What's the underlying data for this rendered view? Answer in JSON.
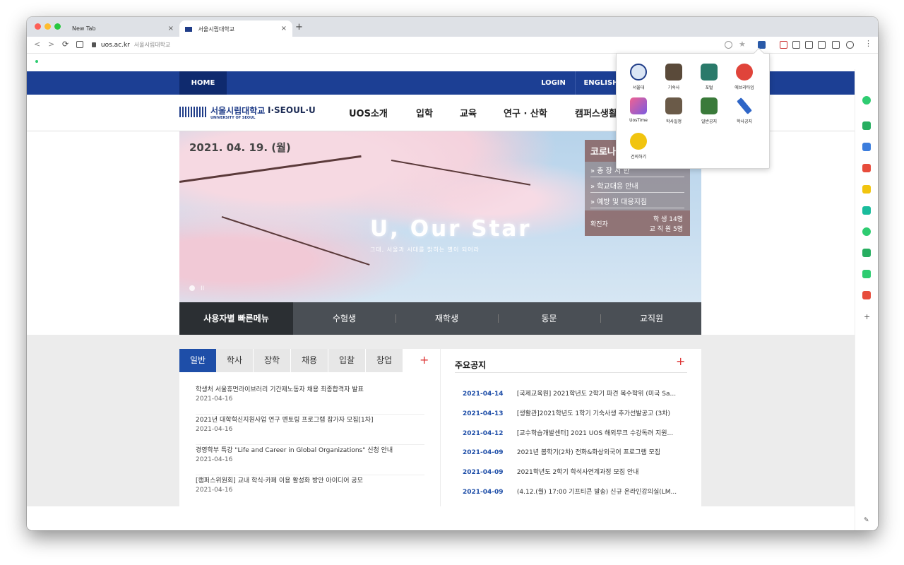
{
  "browser": {
    "tabs": [
      {
        "label": "New Tab",
        "active": false
      },
      {
        "label": "서울시립대학교",
        "active": true
      }
    ],
    "new_tab_symbol": "+",
    "close_symbol": "×",
    "url": "uos.ac.kr",
    "url_title": "서울시립대학교",
    "back_symbol": "<",
    "forward_symbol": ">",
    "reload_symbol": "⟳"
  },
  "site": {
    "topnav": {
      "home": "HOME",
      "login": "LOGIN",
      "english": "ENGLISH"
    },
    "logo": {
      "korean": "서울시립대학교",
      "english": "UNIVERSITY OF SEOUL",
      "slogan": "I·SEOUL·U"
    },
    "mainnav": [
      "UOS소개",
      "입학",
      "교육",
      "연구 · 산학",
      "캠퍼스생활"
    ],
    "hero": {
      "date": "2021. 04. 19. (월)",
      "headline": "U, Our Star",
      "subline": "그대, 서울과 시대를 밝히는 별이 되어라",
      "covid": {
        "title": "코로나",
        "links": [
          "» 총 장 서 한",
          "» 학교대응 안내",
          "» 예방 및 대응지침"
        ],
        "stat_label": "확진자",
        "stat_row1": "학 생  14명",
        "stat_row2": "교 직 원  5명"
      },
      "pause_symbol": "II"
    },
    "quickmenu": {
      "label": "사용자별 빠른메뉴",
      "items": [
        "수험생",
        "재학생",
        "동문",
        "교직원"
      ]
    },
    "notice": {
      "tabs": [
        "일반",
        "학사",
        "장학",
        "채용",
        "입찰",
        "창업"
      ],
      "plus": "+",
      "items": [
        {
          "title": "학생처 서울휴먼라이브러리 기간제노동자 채용 최종합격자 발표",
          "date": "2021-04-16"
        },
        {
          "title": "2021년 대학혁신지원사업 연구 멘토링 프로그램 참가자 모집[1차]",
          "date": "2021-04-16"
        },
        {
          "title": "경영학부 특강 \"Life and Career in Global Organizations\" 신청 안내",
          "date": "2021-04-16"
        },
        {
          "title": "[캠퍼스위원회] 교내 학식·카페 이용 활성화 방안 아이디어 공모",
          "date": "2021-04-16"
        }
      ]
    },
    "major": {
      "title": "주요공지",
      "plus": "+",
      "items": [
        {
          "date": "2021-04-14",
          "title": "[국제교육원] 2021학년도 2학기 파견 복수학위 (미국 Sa..."
        },
        {
          "date": "2021-04-13",
          "title": "[생활관]2021학년도 1학기 기숙사생 추가선발공고 (3차)"
        },
        {
          "date": "2021-04-12",
          "title": "[교수학습개발센터] 2021 UOS 해외무크 수강독려 지원..."
        },
        {
          "date": "2021-04-09",
          "title": "2021년 봄학기(2차) 전화&화상외국어 프로그램 모집"
        },
        {
          "date": "2021-04-09",
          "title": "2021학년도 2학기 학석사연계과정 모집 안내"
        },
        {
          "date": "2021-04-09",
          "title": "(4.12.(월) 17:00 기프티콘 발송) 신규 온라인강의실(LM..."
        }
      ]
    }
  },
  "extension_popup": {
    "apps": [
      {
        "label": "서울대",
        "icon": "university-seal-icon",
        "color": "#dbe6f5"
      },
      {
        "label": "기숙사",
        "icon": "dormitory-icon",
        "color": "#5a4a3a"
      },
      {
        "label": "포털",
        "icon": "portal-icon",
        "color": "#2a7a6a"
      },
      {
        "label": "에브리타임",
        "icon": "alarm-clock-icon",
        "color": "#e0443a"
      },
      {
        "label": "UosTime",
        "icon": "uostime-icon",
        "color": "#7b5be0"
      },
      {
        "label": "학사일정",
        "icon": "clipboard-icon",
        "color": "#6a5a48"
      },
      {
        "label": "일반공지",
        "icon": "notice-board-icon",
        "color": "#3a7a3a"
      },
      {
        "label": "학사공지",
        "icon": "pen-icon",
        "color": "#2f66c7"
      },
      {
        "label": "건의하기",
        "icon": "chat-bubble-icon",
        "color": "#f1c40f"
      }
    ]
  },
  "colors": {
    "brand_blue": "#1c3f94",
    "accent_red": "#d33"
  }
}
